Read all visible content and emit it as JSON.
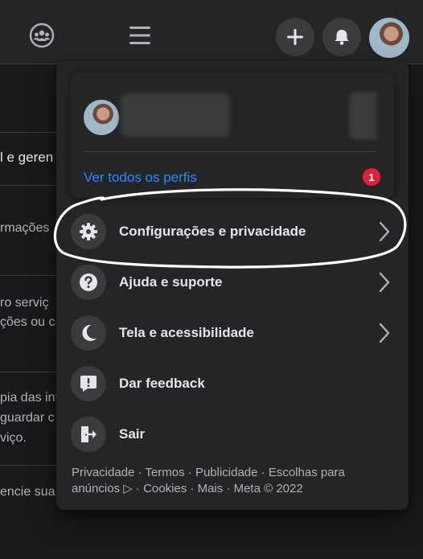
{
  "background": {
    "lines": [
      "l e geren",
      "rmações",
      "ro serviç",
      "ções ou c",
      "pia das inf",
      "guardar c",
      "viço.",
      "encie sua"
    ]
  },
  "profile": {
    "see_all_label": "Ver todos os perfis",
    "notification_count": "1"
  },
  "menu": {
    "items": [
      {
        "label": "Configurações e privacidade",
        "icon": "gear-icon",
        "has_chevron": true
      },
      {
        "label": "Ajuda e suporte",
        "icon": "help-icon",
        "has_chevron": true
      },
      {
        "label": "Tela e acessibilidade",
        "icon": "moon-icon",
        "has_chevron": true
      },
      {
        "label": "Dar feedback",
        "icon": "feedback-icon",
        "has_chevron": false
      },
      {
        "label": "Sair",
        "icon": "logout-icon",
        "has_chevron": false
      }
    ]
  },
  "footer": {
    "line1": "Privacidade · Termos · Publicidade · Escolhas para",
    "line2": "anúncios ▷ · Cookies · Mais · Meta © 2022"
  },
  "colors": {
    "accent": "#2d88ff",
    "badge": "#e41e3f",
    "surface": "#242526",
    "background": "#18191a"
  }
}
